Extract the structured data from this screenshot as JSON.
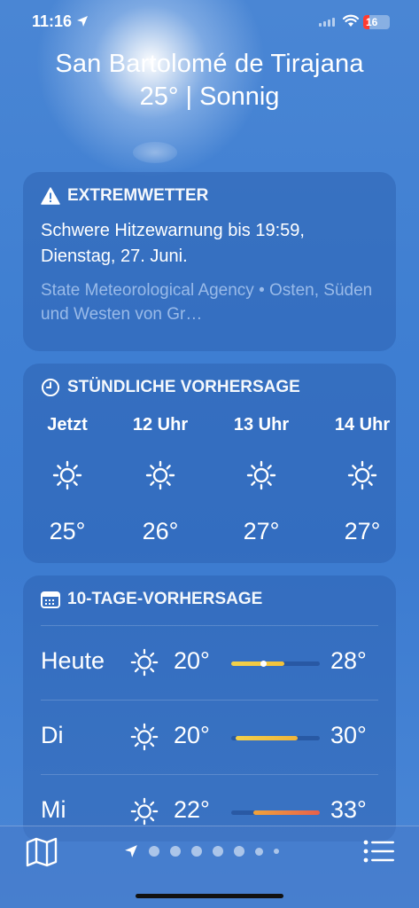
{
  "status": {
    "time": "11:16",
    "battery": "16"
  },
  "header": {
    "city": "San Bartolomé de Tirajana",
    "condition": "25° | Sonnig"
  },
  "alert": {
    "title": "EXTREMWETTER",
    "text": "Schwere Hitzewarnung bis 19:59, Dienstag, 27. Juni.",
    "source": "State Meteorological Agency • Osten, Süden und Westen von Gr…"
  },
  "hourly": {
    "title": "STÜNDLICHE VORHERSAGE",
    "items": [
      {
        "label": "Jetzt",
        "icon": "sun-icon",
        "temp": "25°"
      },
      {
        "label": "12 Uhr",
        "icon": "sun-icon",
        "temp": "26°"
      },
      {
        "label": "13 Uhr",
        "icon": "sun-icon",
        "temp": "27°"
      },
      {
        "label": "14 Uhr",
        "icon": "sun-icon",
        "temp": "27°"
      }
    ]
  },
  "daily": {
    "title": "10-TAGE-VORHERSAGE",
    "days": [
      {
        "name": "Heute",
        "icon": "sun-icon",
        "low": "20°",
        "high": "28°",
        "range_start": 0.0,
        "range_end": 0.6,
        "current": 0.36,
        "gradient": [
          "#f2d14b",
          "#f2c13a"
        ]
      },
      {
        "name": "Di",
        "icon": "sun-icon",
        "low": "20°",
        "high": "30°",
        "range_start": 0.05,
        "range_end": 0.75,
        "current": null,
        "gradient": [
          "#f2d14b",
          "#f0b43a"
        ]
      },
      {
        "name": "Mi",
        "icon": "sun-icon",
        "low": "22°",
        "high": "33°",
        "range_start": 0.25,
        "range_end": 1.0,
        "current": null,
        "gradient": [
          "#f0a33a",
          "#e8604a"
        ]
      }
    ]
  },
  "toolbar": {
    "page_count": 7,
    "active_page": 0
  }
}
